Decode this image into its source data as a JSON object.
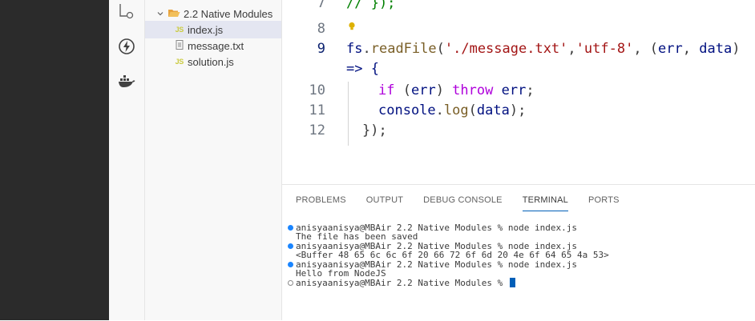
{
  "sidebar": {
    "folder": "2.2 Native Modules",
    "files": [
      {
        "label": "index.js",
        "badge": "JS",
        "selected": true
      },
      {
        "label": "message.txt",
        "badge": "",
        "selected": false
      },
      {
        "label": "solution.js",
        "badge": "JS",
        "selected": false
      }
    ]
  },
  "editor": {
    "lines": [
      {
        "n": "7"
      },
      {
        "n": "8"
      },
      {
        "n": "9"
      },
      {
        "n": ""
      },
      {
        "n": "10"
      },
      {
        "n": "11"
      },
      {
        "n": "12"
      }
    ],
    "code": {
      "l7": "// });",
      "l9_obj": "fs",
      "l9_dot": ".",
      "l9_fn": "readFile",
      "l9_p1": "(",
      "l9_s1": "'./message.txt'",
      "l9_c1": ",",
      "l9_s2": "'utf-8'",
      "l9_c2": ", (",
      "l9_v1": "err",
      "l9_c3": ", ",
      "l9_v2": "data",
      "l9_p2": ")",
      "l9b": "=> {",
      "l10_if": "if",
      "l10_a": " (",
      "l10_v": "err",
      "l10_b": ") ",
      "l10_throw": "throw",
      "l10_sp": " ",
      "l10_v2": "err",
      "l10_end": ";",
      "l11_obj": "console",
      "l11_dot": ".",
      "l11_fn": "log",
      "l11_a": "(",
      "l11_v": "data",
      "l11_b": ");",
      "l12": "});"
    }
  },
  "panel": {
    "tabs": [
      "PROBLEMS",
      "OUTPUT",
      "DEBUG CONSOLE",
      "TERMINAL",
      "PORTS"
    ],
    "active_tab": "TERMINAL",
    "terminal": [
      {
        "marker": "blue",
        "text": "anisyaanisya@MBAir 2.2 Native Modules % node index.js"
      },
      {
        "marker": "none",
        "text": "The file has been saved"
      },
      {
        "marker": "blue",
        "text": "anisyaanisya@MBAir 2.2 Native Modules % node index.js"
      },
      {
        "marker": "none",
        "text": "<Buffer 48 65 6c 6c 6f 20 66 72 6f 6d 20 4e 6f 64 65 4a 53>"
      },
      {
        "marker": "blue",
        "text": "anisyaanisya@MBAir 2.2 Native Modules % node index.js"
      },
      {
        "marker": "none",
        "text": "Hello from NodeJS"
      },
      {
        "marker": "hollow",
        "text": "anisyaanisya@MBAir 2.2 Native Modules % "
      }
    ]
  },
  "colors": {
    "accent": "#005fb8",
    "string": "#a31515",
    "keyword": "#af00db",
    "function": "#795e26",
    "variable": "#001080"
  }
}
